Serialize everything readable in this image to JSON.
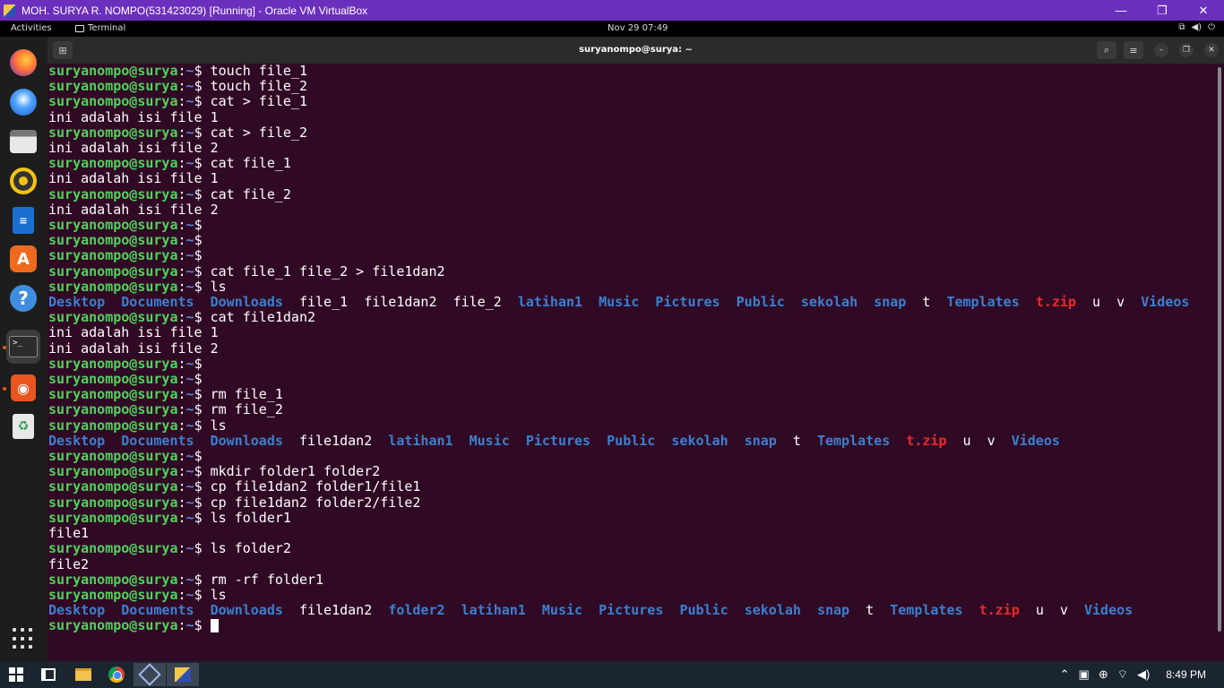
{
  "window": {
    "title": "MOH. SURYA R. NOMPO(531423029) [Running] - Oracle VM VirtualBox",
    "minimize": "—",
    "restore": "❐",
    "close": "✕"
  },
  "topbar": {
    "activities": "Activities",
    "app": "Terminal",
    "clock": "Nov 29  07:49"
  },
  "terminal": {
    "title": "suryanompo@surya: ~",
    "prompt_user": "suryanompo@surya",
    "prompt_path": "~",
    "lines": [
      {
        "p": 1,
        "c": "touch file_1"
      },
      {
        "p": 1,
        "c": "touch file_2"
      },
      {
        "p": 1,
        "c": "cat > file_1"
      },
      {
        "o": "ini adalah isi file 1"
      },
      {
        "p": 1,
        "c": "cat > file_2"
      },
      {
        "o": "ini adalah isi file 2"
      },
      {
        "p": 1,
        "c": "cat file_1"
      },
      {
        "o": "ini adalah isi file 1"
      },
      {
        "p": 1,
        "c": "cat file_2"
      },
      {
        "o": "ini adalah isi file 2"
      },
      {
        "p": 1,
        "c": ""
      },
      {
        "p": 1,
        "c": ""
      },
      {
        "p": 1,
        "c": ""
      },
      {
        "p": 1,
        "c": "cat file_1 file_2 > file1dan2"
      },
      {
        "p": 1,
        "c": "ls"
      },
      {
        "ls": [
          [
            "Desktop",
            "d"
          ],
          [
            "Documents",
            "d"
          ],
          [
            "Downloads",
            "d"
          ],
          [
            "file_1",
            "f"
          ],
          [
            "file1dan2",
            "f"
          ],
          [
            "file_2",
            "f"
          ],
          [
            "latihan1",
            "d"
          ],
          [
            "Music",
            "d"
          ],
          [
            "Pictures",
            "d"
          ],
          [
            "Public",
            "d"
          ],
          [
            "sekolah",
            "d"
          ],
          [
            "snap",
            "d"
          ],
          [
            "t",
            "f"
          ],
          [
            "Templates",
            "d"
          ],
          [
            "t.zip",
            "z"
          ],
          [
            "u",
            "f"
          ],
          [
            "v",
            "f"
          ],
          [
            "Videos",
            "d"
          ]
        ]
      },
      {
        "p": 1,
        "c": "cat file1dan2"
      },
      {
        "o": "ini adalah isi file 1"
      },
      {
        "o": "ini adalah isi file 2"
      },
      {
        "p": 1,
        "c": ""
      },
      {
        "p": 1,
        "c": ""
      },
      {
        "p": 1,
        "c": "rm file_1"
      },
      {
        "p": 1,
        "c": "rm file_2"
      },
      {
        "p": 1,
        "c": "ls"
      },
      {
        "ls": [
          [
            "Desktop",
            "d"
          ],
          [
            "Documents",
            "d"
          ],
          [
            "Downloads",
            "d"
          ],
          [
            "file1dan2",
            "f"
          ],
          [
            "latihan1",
            "d"
          ],
          [
            "Music",
            "d"
          ],
          [
            "Pictures",
            "d"
          ],
          [
            "Public",
            "d"
          ],
          [
            "sekolah",
            "d"
          ],
          [
            "snap",
            "d"
          ],
          [
            "t",
            "f"
          ],
          [
            "Templates",
            "d"
          ],
          [
            "t.zip",
            "z"
          ],
          [
            "u",
            "f"
          ],
          [
            "v",
            "f"
          ],
          [
            "Videos",
            "d"
          ]
        ]
      },
      {
        "p": 1,
        "c": ""
      },
      {
        "p": 1,
        "c": "mkdir folder1 folder2"
      },
      {
        "p": 1,
        "c": "cp file1dan2 folder1/file1"
      },
      {
        "p": 1,
        "c": "cp file1dan2 folder2/file2"
      },
      {
        "p": 1,
        "c": "ls folder1"
      },
      {
        "o": "file1"
      },
      {
        "p": 1,
        "c": "ls folder2"
      },
      {
        "o": "file2"
      },
      {
        "p": 1,
        "c": "rm -rf folder1"
      },
      {
        "p": 1,
        "c": "ls"
      },
      {
        "ls": [
          [
            "Desktop",
            "d"
          ],
          [
            "Documents",
            "d"
          ],
          [
            "Downloads",
            "d"
          ],
          [
            "file1dan2",
            "f"
          ],
          [
            "folder2",
            "d"
          ],
          [
            "latihan1",
            "d"
          ],
          [
            "Music",
            "d"
          ],
          [
            "Pictures",
            "d"
          ],
          [
            "Public",
            "d"
          ],
          [
            "sekolah",
            "d"
          ],
          [
            "snap",
            "d"
          ],
          [
            "t",
            "f"
          ],
          [
            "Templates",
            "d"
          ],
          [
            "t.zip",
            "z"
          ],
          [
            "u",
            "f"
          ],
          [
            "v",
            "f"
          ],
          [
            "Videos",
            "d"
          ]
        ]
      },
      {
        "p": 1,
        "c": "",
        "cursor": 1
      }
    ]
  },
  "dock": {
    "items": [
      "firefox-icon",
      "thunderbird-icon",
      "files-icon",
      "rhythmbox-icon",
      "libreoffice-writer-icon",
      "software-center-icon",
      "help-icon",
      "terminal-icon",
      "ubuntu-installer-icon",
      "trash-icon"
    ]
  },
  "colors": {
    "background": "#300a24",
    "prompt": "#4ed35a",
    "path": "#5a86d6",
    "directory": "#3b80d0",
    "archive": "#ef2929"
  },
  "taskbar": {
    "time": "8:49 PM"
  }
}
